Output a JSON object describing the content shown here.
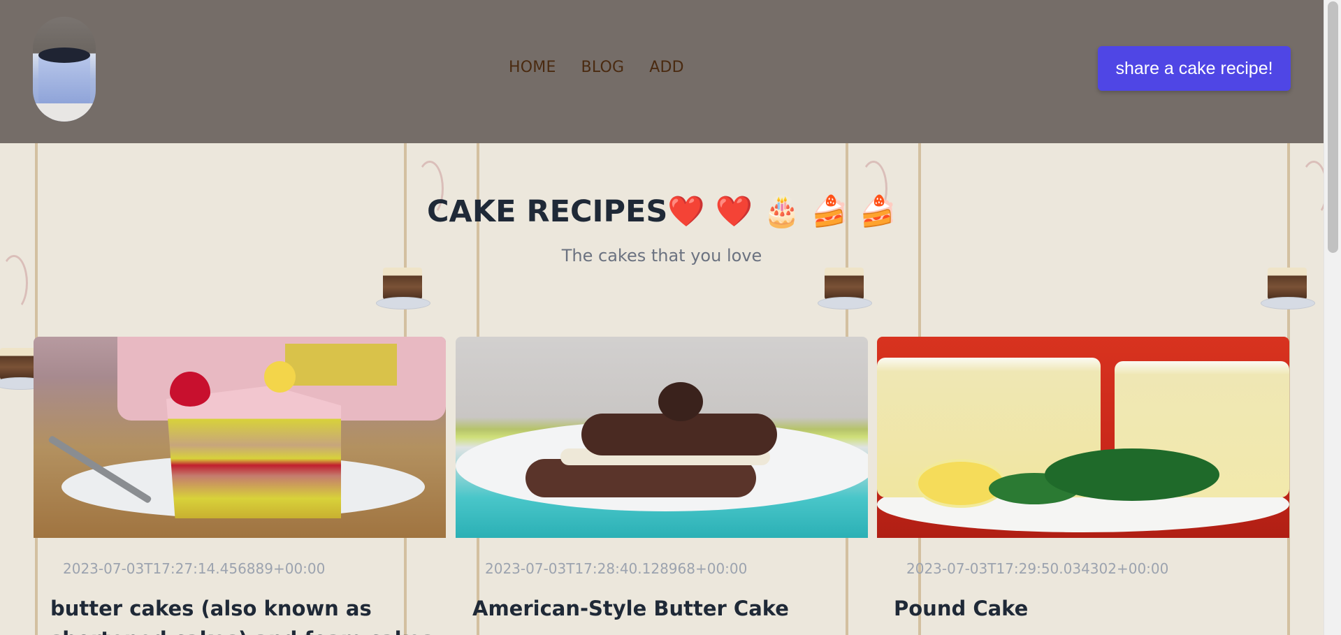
{
  "header": {
    "nav": [
      "HOME",
      "BLOG",
      "ADD"
    ],
    "cta_label": "share a cake recipe!"
  },
  "hero": {
    "title": "CAKE RECIPES❤️ ❤️ 🎂 🍰 🍰",
    "subtitle": "The cakes that you love"
  },
  "cards": [
    {
      "date": "2023-07-03T17:27:14.456889+00:00",
      "title": "butter cakes (also known as shortened cakes) and foam cakes"
    },
    {
      "date": "2023-07-03T17:28:40.128968+00:00",
      "title": "American-Style Butter Cake"
    },
    {
      "date": "2023-07-03T17:29:50.034302+00:00",
      "title": "Pound Cake"
    }
  ],
  "colors": {
    "header_bg": "#756d68",
    "nav_text": "#4a2a10",
    "cta_bg": "#4f46e5",
    "title_text": "#1f2937",
    "date_text": "#9ca3af"
  }
}
